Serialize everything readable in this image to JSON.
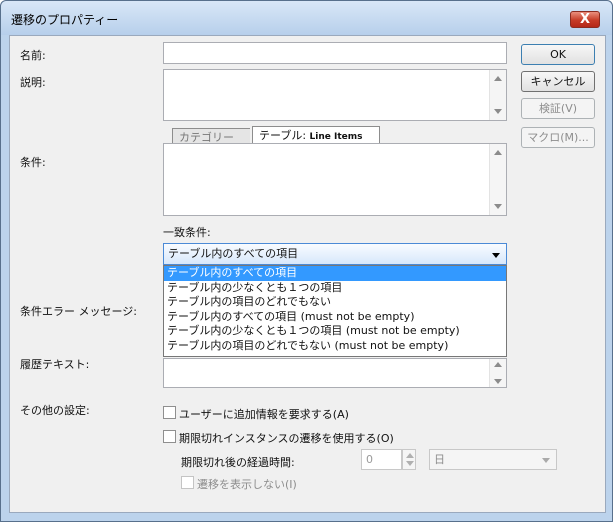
{
  "window": {
    "title": "遷移のプロパティー",
    "close_symbol": "X"
  },
  "labels": {
    "name": "名前:",
    "description": "説明:",
    "condition": "条件:",
    "condition_error": "条件エラー メッセージ:",
    "history_text": "履歴テキスト:",
    "other_settings": "その他の設定:"
  },
  "buttons": {
    "ok": "OK",
    "cancel": "キャンセル",
    "verify": "検証(V)",
    "macro": "マクロ(M)..."
  },
  "tabs": {
    "category": "カテゴリー",
    "table_prefix": "テーブル:",
    "table_name": "Line Items"
  },
  "match": {
    "label": "一致条件:",
    "selected": "テーブル内のすべての項目",
    "options": [
      "テーブル内のすべての項目",
      "テーブル内の少なくとも１つの項目",
      "テーブル内の項目のどれでもない",
      "テーブル内のすべての項目 (must not be empty)",
      "テーブル内の少なくとも１つの項目 (must not be empty)",
      "テーブル内の項目のどれでもない (must not be empty)"
    ]
  },
  "settings": {
    "request_info": "ユーザーに追加情報を要求する(A)",
    "expired_transition": "期限切れインスタンスの遷移を使用する(O)",
    "elapsed_time_label": "期限切れ後の経過時間:",
    "elapsed_value": "0",
    "elapsed_unit": "日",
    "hide_transition": "遷移を表示しない(I)"
  }
}
